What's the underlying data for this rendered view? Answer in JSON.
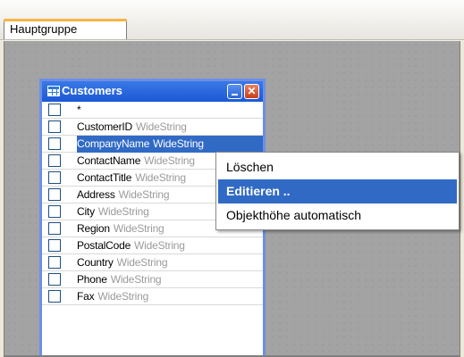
{
  "tabs": [
    {
      "label": "Hauptgruppe",
      "active": true
    }
  ],
  "table": {
    "title": "Customers",
    "icon": "table-grid-icon",
    "title_color": "#2460dc",
    "fields": [
      {
        "name": "*",
        "type": ""
      },
      {
        "name": "CustomerID",
        "type": "WideString"
      },
      {
        "name": "CompanyName",
        "type": "WideString",
        "selected": true
      },
      {
        "name": "ContactName",
        "type": "WideString"
      },
      {
        "name": "ContactTitle",
        "type": "WideString"
      },
      {
        "name": "Address",
        "type": "WideString"
      },
      {
        "name": "City",
        "type": "WideString"
      },
      {
        "name": "Region",
        "type": "WideString"
      },
      {
        "name": "PostalCode",
        "type": "WideString"
      },
      {
        "name": "Country",
        "type": "WideString"
      },
      {
        "name": "Phone",
        "type": "WideString"
      },
      {
        "name": "Fax",
        "type": "WideString"
      }
    ]
  },
  "context_menu": {
    "items": [
      {
        "label": "Löschen",
        "highlighted": false
      },
      {
        "label": "Editieren ..",
        "highlighted": true
      },
      {
        "label": "Objekthöhe automatisch",
        "highlighted": false
      }
    ]
  },
  "colors": {
    "selection": "#316ac5",
    "canvas": "#a3a3a3",
    "window_border": "#6b8fe8"
  }
}
